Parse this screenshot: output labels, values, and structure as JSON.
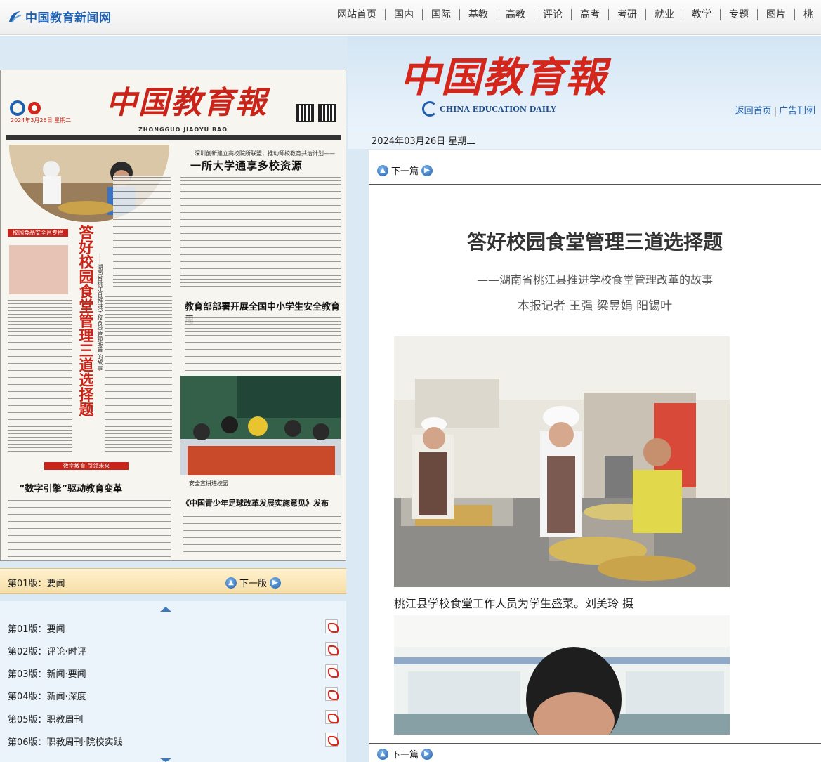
{
  "site": {
    "logo_text": "中国教育新闻网",
    "nav": [
      "网站首页",
      "国内",
      "国际",
      "基教",
      "高教",
      "评论",
      "高考",
      "考研",
      "就业",
      "教学",
      "专题",
      "图片",
      "桃"
    ]
  },
  "masthead": {
    "title": "中国教育報",
    "subtitle": "CHINA EDUCATION DAILY",
    "links": {
      "home": "返回首页",
      "ads": "广告刊例"
    }
  },
  "date": "2024年03月26日 星期二",
  "article": {
    "next_label": "下一篇",
    "title": "答好校园食堂管理三道选择题",
    "subtitle": "——湖南省桃江县推进学校食堂管理改革的故事",
    "authors": "本报记者 王强 梁昱娟 阳锡叶",
    "photo_caption": "桃江县学校食堂工作人员为学生盛菜。刘美玲 摄"
  },
  "epaper": {
    "title": "中国教育報",
    "pinyin": "ZHONGGUO JIAOYU BAO",
    "date": "2024年3月26日 星期二",
    "headline_top_sub": "深圳创新建立高校院所联盟，推动师校教育共治计划——",
    "headline_top": "一所大学通享多校资源",
    "vertical_headline": "答好校园食堂管理三道选择题",
    "vertical_sub": "——湖南省桃江县推进学校食堂管理改革的故事",
    "headline_2": "教育部部署开展全国中小学生安全教育周",
    "headline_3_tag": "数字教育 引领未来",
    "headline_3": "“数字引擎”驱动教育变革",
    "headline_4": "《中国青少年足球改革发展实施意见》发布",
    "photo_b_caption": "安全宣讲进校园",
    "tag1": "校园食品安全月专栏"
  },
  "edition": {
    "current": "第01版：要闻",
    "next_label": "下一版",
    "list": [
      "第01版：要闻",
      "第02版：评论·时评",
      "第03版：新闻·要闻",
      "第04版：新闻·深度",
      "第05版：职教周刊",
      "第06版：职教周刊·院校实践"
    ]
  },
  "colors": {
    "brand_red": "#d5261b",
    "link_blue": "#1f5fae",
    "band_blue": "#dbe9f5"
  }
}
